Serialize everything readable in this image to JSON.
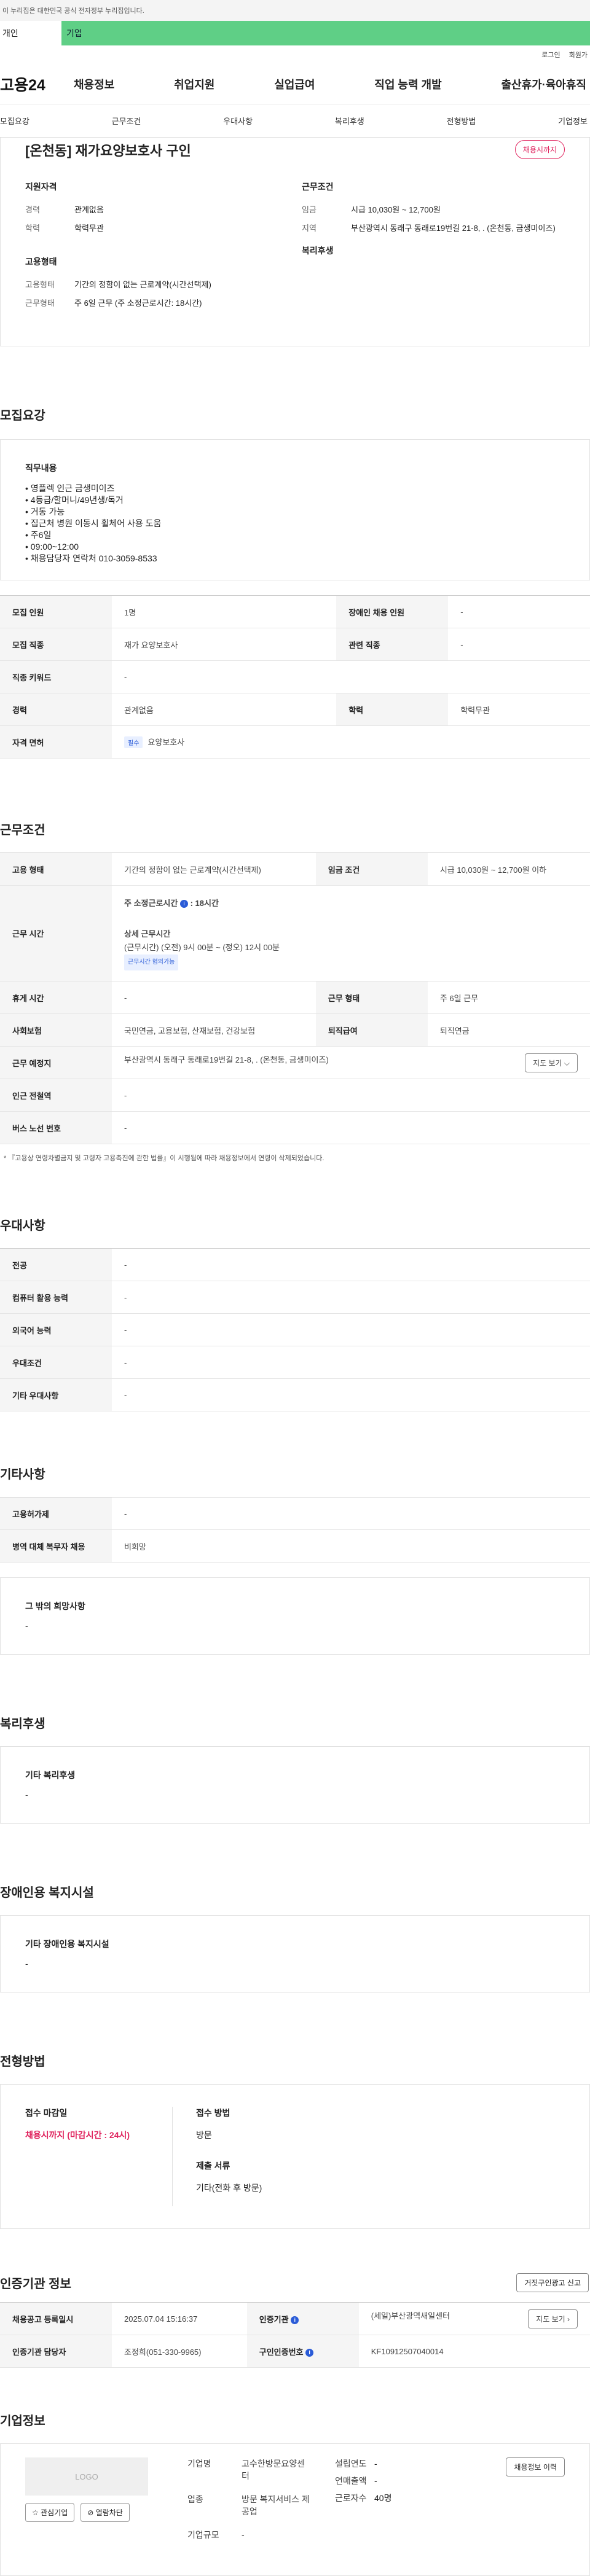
{
  "gov_bar": "이 누리집은 대한민국 공식 전자정부 누리집입니다.",
  "service_tabs": [
    "개인",
    "기업"
  ],
  "util_links": [
    "로그인",
    "회원가"
  ],
  "logo": "고용24",
  "gnb": [
    "채용정보",
    "취업지원",
    "실업급여",
    "직업 능력 개발",
    "출산휴가·육아휴직"
  ],
  "anchor_nav": [
    "모집요강",
    "근무조건",
    "우대사항",
    "복리후생",
    "전형방법",
    "기업정보"
  ],
  "summary": {
    "title": "[온천동] 재가요양보호사 구인",
    "badge": "채용시까지",
    "qual_head": "지원자격",
    "work_head": "근무조건",
    "emp_head": "고용형태",
    "welfare_head": "복리후생",
    "career_k": "경력",
    "career_v": "관계없음",
    "edu_k": "학력",
    "edu_v": "학력무관",
    "wage_k": "임금",
    "wage_v": "시급 10,030원 ~ 12,700원",
    "region_k": "지역",
    "region_v": "부산광역시 동래구 동래로19번길 21-8, . (온천동, 금생미이즈)",
    "etype_k": "고용형태",
    "etype_v": "기간의 정함이 없는 근로계약(시간선택제)",
    "wform_k": "근무형태",
    "wform_v": "주 6일 근무 (주 소정근로시간: 18시간)"
  },
  "recruit": {
    "title": "모집요강",
    "duty_title": "직무내용",
    "duties": [
      "• 영플렉 인근 금생미이즈",
      "• 4등급/할머니/49년생/독거",
      "• 거동 가능",
      "• 집근처 병원 이동시 휠체어 사용 도움",
      "• 주6일",
      "• 09:00~12:00",
      "• 채용담당자 연락처 010-3059-8533"
    ],
    "rows": {
      "count_k": "모집 인원",
      "count_v": "1명",
      "disab_k": "장애인 채용 인원",
      "disab_v": "-",
      "job_k": "모집 직종",
      "job_v": "재가 요양보호사",
      "rel_k": "관련 직종",
      "rel_v": "-",
      "kw_k": "직종 키워드",
      "kw_v": "-",
      "career_k": "경력",
      "career_v": "관계없음",
      "edu_k": "학력",
      "edu_v": "학력무관",
      "cert_k": "자격 면허",
      "cert_tag": "필수",
      "cert_v": "요양보호사"
    }
  },
  "work": {
    "title": "근무조건",
    "etype_k": "고용 형태",
    "etype_v": "기간의 정함이 없는 근로계약(시간선택제)",
    "wage_k": "임금 조건",
    "wage_v": "시급 10,030원 ~ 12,700원 이하",
    "hours_k": "근무 시간",
    "weekly_label": "주 소정근로시간",
    "weekly_val": ": 18시간",
    "detail_label": "상세 근무시간",
    "detail_val": "(근무시간) (오전) 9시 00분 ~ (정오) 12시 00분",
    "detail_tag": "근무시간 협의가능",
    "rest_k": "휴게 시간",
    "rest_v": "-",
    "form_k": "근무 형태",
    "form_v": "주 6일 근무",
    "ins_k": "사회보험",
    "ins_v": "국민연금, 고용보험, 산재보험, 건강보험",
    "sev_k": "퇴직급여",
    "sev_v": "퇴직연금",
    "place_k": "근무 예정지",
    "place_v": "부산광역시 동래구 동래로19번길 21-8, . (온천동, 금생미이즈)",
    "map_btn": "지도 보기 ⌵",
    "station_k": "인근 전철역",
    "station_v": "-",
    "bus_k": "버스 노선 번호",
    "bus_v": "-",
    "note": "* 『고용상 연령차별금지 및 고령자 고용촉진에 관한 법률』이 시행됨에 따라 채용정보에서 연령이 삭제되었습니다."
  },
  "pref": {
    "title": "우대사항",
    "major_k": "전공",
    "major_v": "-",
    "pc_k": "컴퓨터 활용 능력",
    "pc_v": "-",
    "lang_k": "외국어 능력",
    "lang_v": "-",
    "pcond_k": "우대조건",
    "pcond_v": "-",
    "etc_k": "기타 우대사항",
    "etc_v": "-"
  },
  "etc": {
    "title": "기타사항",
    "dorm_k": "고용허가제",
    "dorm_v": "-",
    "mil_k": "병역 대체 복무자 채용",
    "mil_v": "비희망",
    "wish_title": "그 밖의 희망사항",
    "wish_v": "-"
  },
  "welfare": {
    "title": "복리후생",
    "box_title": "기타 복리후생",
    "box_v": "-"
  },
  "disab": {
    "title": "장애인용 복지시설",
    "box_title": "기타 장애인용 복지시설",
    "box_v": "-"
  },
  "apply": {
    "title": "전형방법",
    "deadline_k": "접수 마감일",
    "deadline_v": "채용시까지 (마감시간 : 24시)",
    "method_k": "접수 방법",
    "method_v": "방문",
    "docs_k": "제출 서류",
    "docs_v": "기타(전화 후 방문)"
  },
  "cert_org": {
    "title": "인증기관 정보",
    "report_btn": "거짓구인광고 신고",
    "reg_k": "채용공고 등록일시",
    "reg_v": "2025.07.04 15:16:37",
    "org_k": "인증기관",
    "org_v": "(세일)부산광역새일센터",
    "map_btn": "지도 보기 ›",
    "mgr_k": "인증기관 담당자",
    "mgr_v": "조정희(051-330-9965)",
    "id_k": "구인인증번호",
    "id_v": "KF10912507040014"
  },
  "corp": {
    "title": "기업정보",
    "logo_text": "LOGO",
    "fav_btn": "☆ 관심기업",
    "block_btn": "⊘ 열람차단",
    "name_k": "기업명",
    "name_v": "고수한방문요양센터",
    "year_k": "설립연도",
    "year_v": "-",
    "sales_k": "연매출액",
    "sales_v": "-",
    "ind_k": "업종",
    "ind_v": "방문 복지서비스 제공업",
    "emp_k": "근로자수",
    "emp_v": "40명",
    "size_k": "기업규모",
    "size_v": "-",
    "jobs_btn": "채용정보 이력"
  }
}
